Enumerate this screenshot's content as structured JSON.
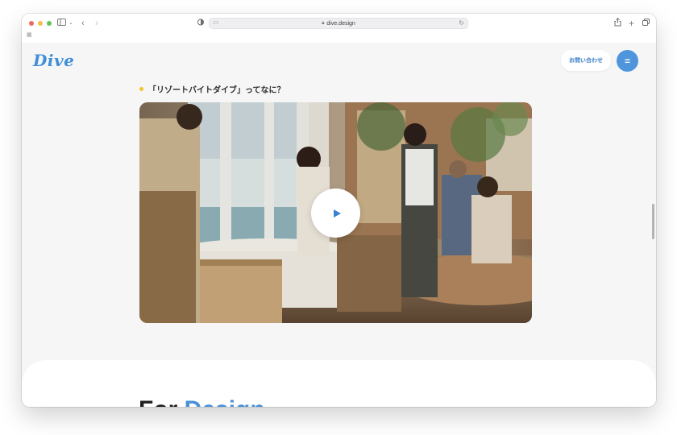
{
  "browser": {
    "url": "dive.design",
    "traffic_lights": [
      "#ed6a5e",
      "#f4bf4f",
      "#61c554"
    ]
  },
  "site": {
    "logo": "Dive",
    "contact_label": "お問い合わせ",
    "menu_glyph": "=",
    "colors": {
      "brand": "#3f8fd8",
      "accent_dot": "#f4c328"
    }
  },
  "section": {
    "heading": "「リゾートバイトダイブ」ってなに？"
  },
  "next_section": {
    "title_part1": "For",
    "title_part2": "Design"
  },
  "icons": {
    "sidebar": "sidebar-icon",
    "back": "chevron-left-icon",
    "forward": "chevron-right-icon",
    "share": "share-icon",
    "new_tab": "plus-icon",
    "tabs": "tab-overview-icon",
    "play": "play-icon"
  }
}
